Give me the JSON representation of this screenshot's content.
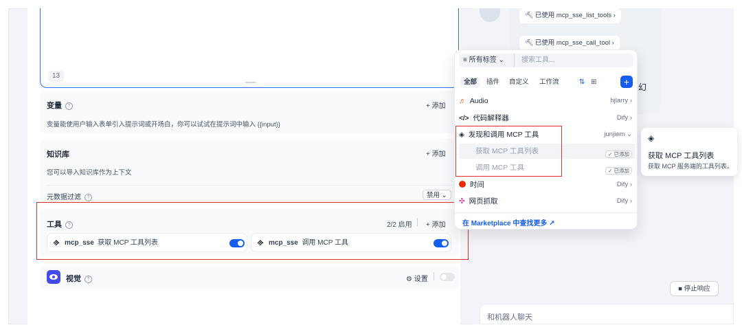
{
  "editor": {
    "char_count": "13"
  },
  "variables": {
    "title": "变量",
    "add_label": "+ 添加",
    "description": "变量能使用户输入表单引入提示词或开场白，你可以试试在提示词中输入 {{input}}"
  },
  "knowledge": {
    "title": "知识库",
    "add_label": "+ 添加",
    "description": "您可以导入知识库作为上下文",
    "metadata_filter_label": "元数据过滤",
    "metadata_filter_value": "禁用"
  },
  "tools": {
    "title": "工具",
    "enabled_count": "2/2 启用",
    "add_label": "+ 添加",
    "items": [
      {
        "provider": "mcp_sse",
        "name": "获取 MCP 工具列表",
        "enabled": true
      },
      {
        "provider": "mcp_sse",
        "name": "调用 MCP 工具",
        "enabled": true
      }
    ]
  },
  "vision": {
    "title": "视觉",
    "settings_label": "设置",
    "enabled": false
  },
  "chat": {
    "tool_chips": [
      "已使用 mcp_sse_list_tools",
      "已使用 mcp_sse_call_tool"
    ],
    "partial_text": "幻",
    "stop_label": "停止响应",
    "input_placeholder": "和机器人聊天"
  },
  "tool_picker": {
    "tag_filter": "所有标签",
    "search_placeholder": "搜索工具...",
    "tabs": [
      "全部",
      "插件",
      "自定义",
      "工作流"
    ],
    "active_tab": "全部",
    "rows": [
      {
        "icon": "audio-icon",
        "name": "Audio",
        "author": "hjlarry"
      },
      {
        "icon": "code-icon",
        "name": "代码解释器",
        "author": "Dify"
      },
      {
        "icon": "mcp-icon",
        "name": "发现和调用 MCP 工具",
        "author": "junjiem"
      },
      {
        "icon": "",
        "name": "获取 MCP 工具列表",
        "author": "已添加"
      },
      {
        "icon": "",
        "name": "调用 MCP 工具",
        "author": "已添加"
      },
      {
        "icon": "clock-icon",
        "name": "时间",
        "author": "Dify"
      },
      {
        "icon": "web-scrape-icon",
        "name": "网页抓取",
        "author": "Dify"
      }
    ],
    "marketplace_link": "在 Marketplace 中查找更多 ↗"
  },
  "tooltip": {
    "title": "获取 MCP 工具列表",
    "description": "获取 MCP 服务端的工具列表。"
  },
  "colors": {
    "accent": "#155eef",
    "highlight_red": "#e02f2f",
    "panel_bg": "#f2f4f7"
  }
}
